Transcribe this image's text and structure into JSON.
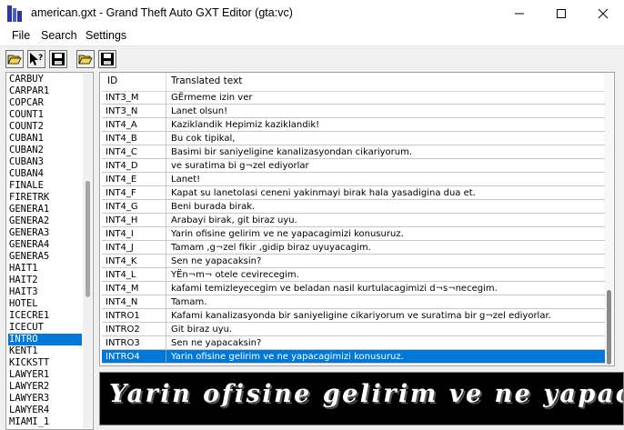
{
  "window": {
    "title": "american.gxt - Grand Theft Auto GXT Editor (gta:vc)",
    "controls": [
      "minimize-icon",
      "maximize-icon",
      "close-icon"
    ]
  },
  "menu": {
    "file": "File",
    "search": "Search",
    "settings": "Settings"
  },
  "toolbar": {
    "buttons": [
      "open-folder-icon",
      "help-pointer-icon",
      "save-icon",
      "open-folder-icon",
      "save-icon"
    ]
  },
  "id_list": {
    "items": [
      "CARBUY",
      "CARPAR1",
      "COPCAR",
      "COUNT1",
      "COUNT2",
      "CUBAN1",
      "CUBAN2",
      "CUBAN3",
      "CUBAN4",
      "FINALE",
      "FIRETRK",
      "GENERA1",
      "GENERA2",
      "GENERA3",
      "GENERA4",
      "GENERA5",
      "HAIT1",
      "HAIT2",
      "HAIT3",
      "HOTEL",
      "ICECRE1",
      "ICECUT",
      "INTRO",
      "KENT1",
      "KICKSTT",
      "LAWYER1",
      "LAWYER2",
      "LAWYER3",
      "LAWYER4",
      "MIAMI_1"
    ],
    "selected": "INTRO"
  },
  "grid": {
    "headers": {
      "id": "ID",
      "text": "Translated text"
    },
    "rows": [
      {
        "id": "INT3_M",
        "text": "GËrmeme izin ver"
      },
      {
        "id": "INT3_N",
        "text": "Lanet olsun!"
      },
      {
        "id": "INT4_A",
        "text": "Kaziklandik Hepimiz kaziklandik!"
      },
      {
        "id": "INT4_B",
        "text": "Bu cok tipikal,"
      },
      {
        "id": "INT4_C",
        "text": "Basimi bir saniyeligine kanalizasyondan cikariyorum."
      },
      {
        "id": "INT4_D",
        "text": "ve suratima bi g¬zel ediyorlar"
      },
      {
        "id": "INT4_E",
        "text": "Lanet!"
      },
      {
        "id": "INT4_F",
        "text": "Kapat su lanetolasi ceneni yakinmayi birak hala yasadigina dua et."
      },
      {
        "id": "INT4_G",
        "text": "Beni burada birak."
      },
      {
        "id": "INT4_H",
        "text": "Arabayi birak, git biraz uyu."
      },
      {
        "id": "INT4_I",
        "text": "Yarin ofisine gelirim ve ne yapacagimizi konusuruz."
      },
      {
        "id": "INT4_J",
        "text": "Tamam ,g¬zel fikir ,gidip biraz uyuyacagim."
      },
      {
        "id": "INT4_K",
        "text": "Sen ne yapacaksin?"
      },
      {
        "id": "INT4_L",
        "text": "YËn¬m¬ otele cevirecegim."
      },
      {
        "id": "INT4_M",
        "text": "kafami temizleyecegim ve beladan nasil kurtulacagimizi d¬s¬necegim."
      },
      {
        "id": "INT4_N",
        "text": "Tamam."
      },
      {
        "id": "INTRO1",
        "text": "Kafami kanalizasyonda bir saniyeligine cikariyorum ve suratima bir g¬zel ediyorlar."
      },
      {
        "id": "INTRO2",
        "text": "Git biraz uyu."
      },
      {
        "id": "INTRO3",
        "text": "Sen ne yapacaksin?"
      },
      {
        "id": "INTRO4",
        "text": "Yarin ofisine gelirim ve ne yapacagimizi konusuruz."
      }
    ],
    "selected_id": "INTRO4"
  },
  "preview": {
    "text": "Yarin ofisine gelirim ve ne yapacagimizi ko"
  }
}
